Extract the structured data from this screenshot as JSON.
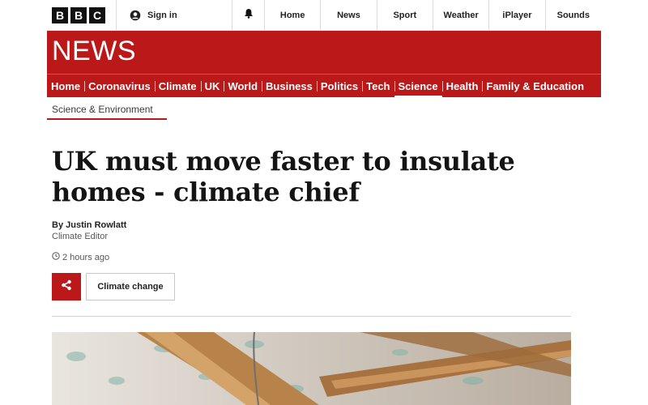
{
  "global_nav": {
    "logo_letters": [
      "B",
      "B",
      "C"
    ],
    "signin_label": "Sign in",
    "links": [
      "Home",
      "News",
      "Sport",
      "Weather",
      "iPlayer",
      "Sounds"
    ]
  },
  "news_header": {
    "logo_text": "NEWS",
    "subnav": [
      "Home",
      "Coronavirus",
      "Climate",
      "UK",
      "World",
      "Business",
      "Politics",
      "Tech",
      "Science",
      "Health",
      "Family & Education"
    ],
    "active_item": "Science",
    "brand_color": "#bb1919"
  },
  "section_label": "Science & Environment",
  "article": {
    "headline": "UK must move faster to insulate homes - climate chief",
    "author": "By Justin Rowlatt",
    "author_role": "Climate Editor",
    "timestamp": "2 hours ago",
    "topic_tag": "Climate change"
  },
  "icons": [
    "user-icon",
    "bell-icon",
    "clock-icon",
    "share-icon"
  ]
}
